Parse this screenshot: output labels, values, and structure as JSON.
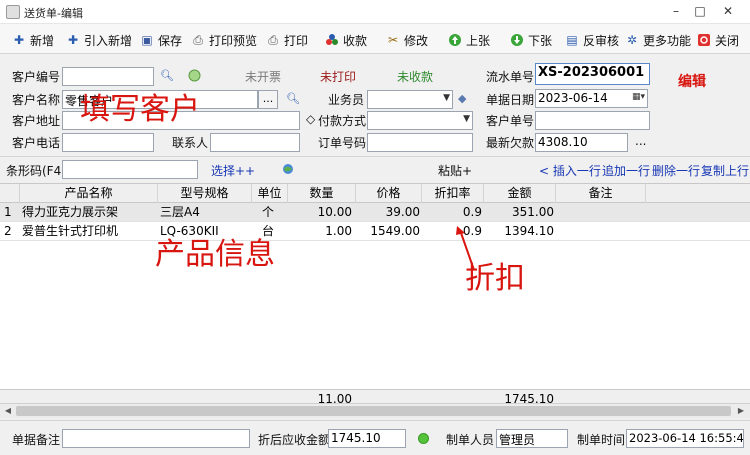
{
  "window": {
    "title": "送货单-编辑",
    "minimize": "–",
    "maximize": "□",
    "close": "✕"
  },
  "toolbar": {
    "new_label": "新增",
    "import_label": "引入新增",
    "save_label": "保存",
    "print_preview_label": "打印预览",
    "print_label": "打印",
    "receive_label": "收款",
    "edit_label": "修改",
    "prev_label": "上张",
    "next_label": "下张",
    "unapprove_label": "反审核",
    "more_label": "更多功能",
    "close_label": "关闭"
  },
  "form": {
    "customer_code_label": "客户编号",
    "customer_code_value": "",
    "customer_name_label": "客户名称",
    "customer_name_value": "零售客户",
    "customer_name_btn": "...",
    "customer_address_label": "客户地址",
    "customer_address_value": "",
    "customer_phone_label": "客户电话",
    "customer_phone_value": "",
    "contact_label": "联系人",
    "contact_value": "",
    "status_invoice": "未开票",
    "status_print": "未打印",
    "status_receive": "未收款",
    "salesman_label": "业务员",
    "salesman_value": "",
    "payment_label": "付款方式",
    "payment_value": "",
    "order_no_label": "订单号码",
    "order_no_value": "",
    "serial_label": "流水单号",
    "serial_value": "XS-202306001",
    "date_label": "单据日期",
    "date_value": "2023-06-14",
    "customer_bill_label": "客户单号",
    "customer_bill_value": "",
    "latest_debt_label": "最新欠款",
    "latest_debt_value": "4308.10",
    "latest_debt_btn": "...",
    "annotation_fill_customer": "填写客户",
    "annotation_edit": "编辑"
  },
  "barcode_bar": {
    "barcode_label": "条形码(F4)",
    "barcode_value": "",
    "select_link": "选择++",
    "paste_label": "粘贴+",
    "insert_row": "< 插入一行",
    "append_row": "追加一行",
    "delete_row": "删除一行",
    "copy_up": "复制上行"
  },
  "grid": {
    "headers": [
      "产品名称",
      "型号规格",
      "单位",
      "数量",
      "价格",
      "折扣率",
      "金额",
      "备注"
    ],
    "rows": [
      {
        "no": "1",
        "name": "得力亚克力展示架",
        "model": "三层A4",
        "unit": "个",
        "qty": "10.00",
        "price": "39.00",
        "discount": "0.9",
        "amount": "351.00",
        "remark": ""
      },
      {
        "no": "2",
        "name": "爱普生针式打印机",
        "model": "LQ-630KII",
        "unit": "台",
        "qty": "1.00",
        "price": "1549.00",
        "discount": "0.9",
        "amount": "1394.10",
        "remark": ""
      }
    ],
    "total_qty": "11.00",
    "total_amount": "1745.10",
    "annotation_product_info": "产品信息",
    "annotation_discount": "折扣"
  },
  "footer": {
    "remark_label": "单据备注",
    "remark_value": "",
    "receivable_label": "折后应收金额",
    "receivable_value": "1745.10",
    "maker_label": "制单人员",
    "maker_value": "管理员",
    "time_label": "制单时间",
    "time_value": "2023-06-14 16:55:43"
  },
  "colors": {
    "accent_blue": "#1736b4",
    "annotation_red": "#d8150f",
    "status_green": "#2f8a2f"
  }
}
